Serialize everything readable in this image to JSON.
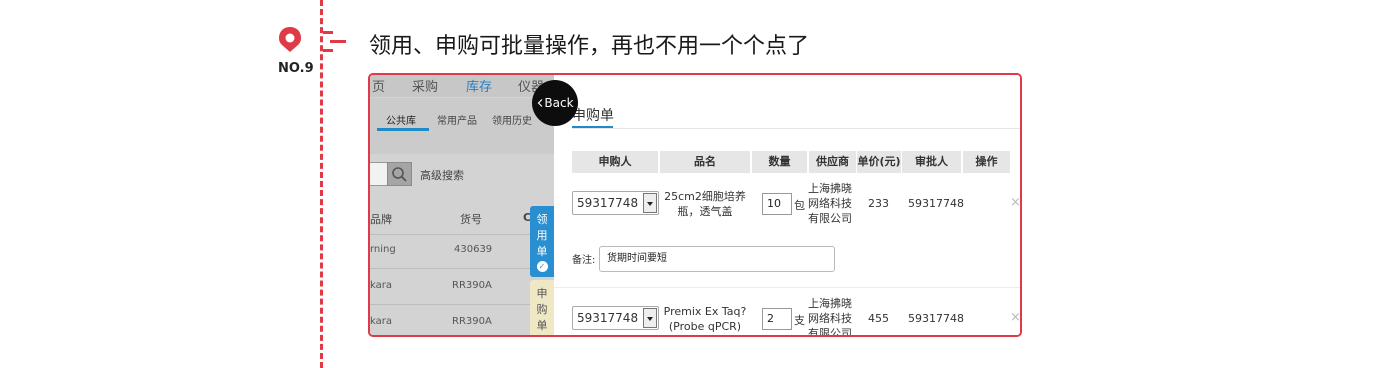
{
  "slide": {
    "number_label": "NO.9",
    "headline": "领用、申购可批量操作，再也不用一个个点了"
  },
  "left_app": {
    "top_nav": [
      "页",
      "采购",
      "库存",
      "仪器"
    ],
    "sub_nav": [
      "公共库",
      "常用产品",
      "领用历史"
    ],
    "advanced_search": "高级搜索",
    "columns": [
      "品牌",
      "货号",
      "C"
    ],
    "rows": [
      {
        "brand": "rning",
        "sku": "430639"
      },
      {
        "brand": "kara",
        "sku": "RR390A"
      },
      {
        "brand": "kara",
        "sku": "RR390A"
      }
    ],
    "side_tabs": {
      "collect": [
        "领",
        "用",
        "单"
      ],
      "collect_icon": "checkmark-icon",
      "purchase": [
        "申",
        "购",
        "单"
      ]
    }
  },
  "back_button": {
    "label": "Back"
  },
  "purchase_panel": {
    "title": "申购单",
    "headers": [
      "申购人",
      "品名",
      "数量",
      "供应商",
      "单价(元)",
      "审批人",
      "操作"
    ],
    "rows": [
      {
        "requester": "59317748",
        "product": [
          "25cm2细胞培养",
          "瓶，透气盖"
        ],
        "qty": "10",
        "unit": "包",
        "supplier": [
          "上海拂晓",
          "网络科技",
          "有限公司"
        ],
        "price": "233",
        "approver": "59317748",
        "delete": "×"
      },
      {
        "requester": "59317748",
        "product": [
          "Premix Ex Taq?",
          "(Probe qPCR)"
        ],
        "qty": "2",
        "unit": "支",
        "supplier": [
          "上海拂晓",
          "网络科技",
          "有限公司"
        ],
        "price": "455",
        "approver": "59317748",
        "delete": "×"
      }
    ],
    "note_label": "备注:",
    "note_value": "货期时间要短"
  },
  "colors": {
    "accent_red": "#e03a47",
    "link_blue": "#1f8ac8",
    "tab_blue": "#2a8fd0"
  }
}
